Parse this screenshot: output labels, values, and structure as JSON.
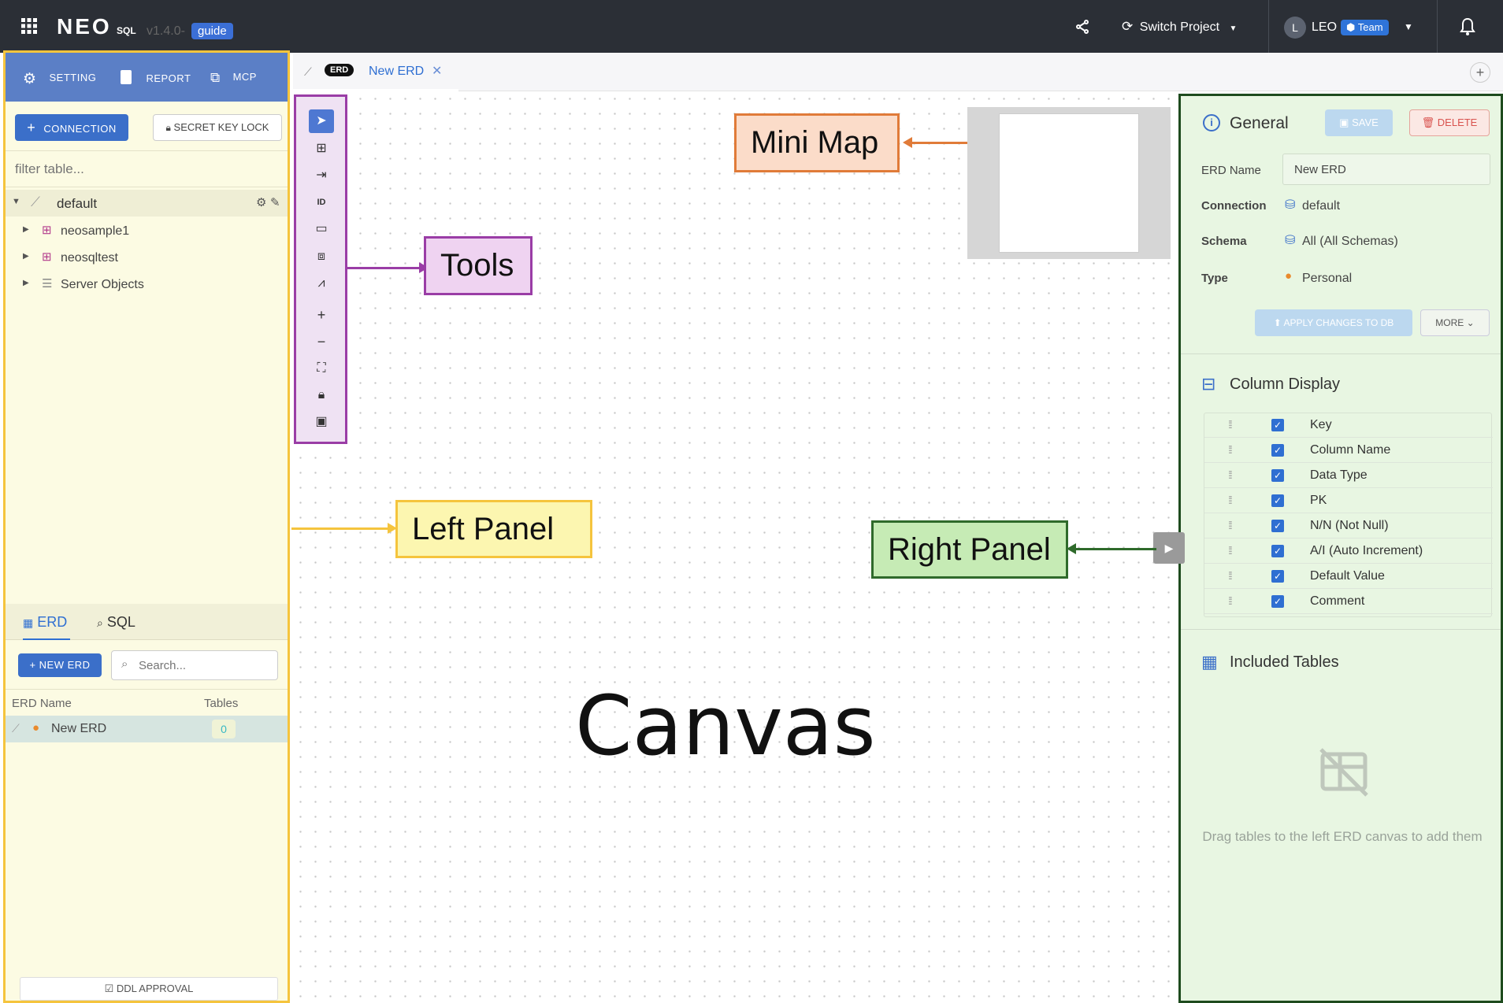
{
  "topbar": {
    "brand": "NEO",
    "brand_sub": "SQL",
    "version": "v1.4.0-",
    "version_badge": "guide",
    "switch_project": "Switch Project",
    "avatar_initial": "L",
    "user_name": "LEO",
    "team_badge": "Team"
  },
  "left_panel": {
    "menu": [
      "SETTING",
      "REPORT",
      "MCP"
    ],
    "connection_button": "CONNECTION",
    "secret_key_button": "SECRET KEY LOCK",
    "filter_placeholder": "filter table...",
    "tree_root": "default",
    "tree_items": [
      "neosample1",
      "neosqltest",
      "Server Objects"
    ],
    "bottom_tabs": [
      "ERD",
      "SQL"
    ],
    "new_erd_button": "NEW ERD",
    "search_placeholder": "Search...",
    "table_headers": [
      "ERD Name",
      "Tables"
    ],
    "erd_rows": [
      {
        "name": "New ERD",
        "tables": "0"
      }
    ],
    "ddl_approval": "DDL APPROVAL"
  },
  "tabs": {
    "erd_badge": "ERD",
    "active_tab": "New ERD"
  },
  "right_panel": {
    "general_title": "General",
    "save_button": "SAVE",
    "delete_button": "DELETE",
    "fields": {
      "erd_name_label": "ERD Name",
      "erd_name_value": "New ERD",
      "connection_label": "Connection",
      "connection_value": "default",
      "schema_label": "Schema",
      "schema_value": "All (All Schemas)",
      "type_label": "Type",
      "type_value": "Personal"
    },
    "apply_button": "APPLY CHANGES TO DB",
    "more_button": "MORE",
    "column_display_title": "Column Display",
    "columns": [
      "Key",
      "Column Name",
      "Data Type",
      "PK",
      "N/N (Not Null)",
      "A/I (Auto Increment)",
      "Default Value",
      "Comment"
    ],
    "included_tables_title": "Included Tables",
    "empty_message": "Drag tables to the left ERD canvas to add them"
  },
  "annotations": {
    "mini_map": "Mini Map",
    "tools": "Tools",
    "left_panel": "Left Panel",
    "right_panel": "Right Panel",
    "canvas": "Canvas"
  },
  "colors": {
    "left_panel_border": "#f5c43d",
    "tools_border": "#9a3da6",
    "right_panel_border": "#1e4b1e",
    "mini_map_border": "#e07b39",
    "accent_blue": "#3b6fc9"
  }
}
